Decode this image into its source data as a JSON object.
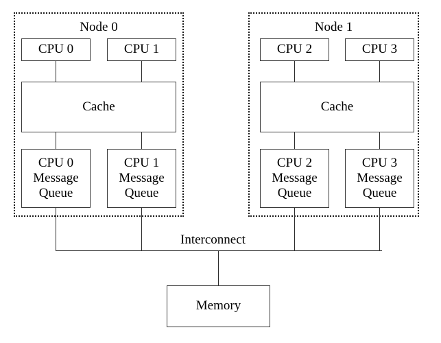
{
  "diagram": {
    "title_text_present": false,
    "nodes": [
      {
        "id": "node0",
        "title": "Node 0",
        "cpus": [
          {
            "label": "CPU 0"
          },
          {
            "label": "CPU 1"
          }
        ],
        "cache": {
          "label": "Cache"
        },
        "queues": [
          {
            "label": "CPU 0\nMessage\nQueue"
          },
          {
            "label": "CPU 1\nMessage\nQueue"
          }
        ]
      },
      {
        "id": "node1",
        "title": "Node 1",
        "cpus": [
          {
            "label": "CPU 2"
          },
          {
            "label": "CPU 3"
          }
        ],
        "cache": {
          "label": "Cache"
        },
        "queues": [
          {
            "label": "CPU 2\nMessage\nQueue"
          },
          {
            "label": "CPU 3\nMessage\nQueue"
          }
        ]
      }
    ],
    "interconnect": {
      "label": "Interconnect"
    },
    "memory": {
      "label": "Memory"
    },
    "colors": {
      "background": "#ffffff",
      "box_stroke": "#3a3a3a",
      "line_stroke": "#2b2b2b",
      "dotted_stroke": "#1a1a1a",
      "text": "#000000"
    }
  }
}
